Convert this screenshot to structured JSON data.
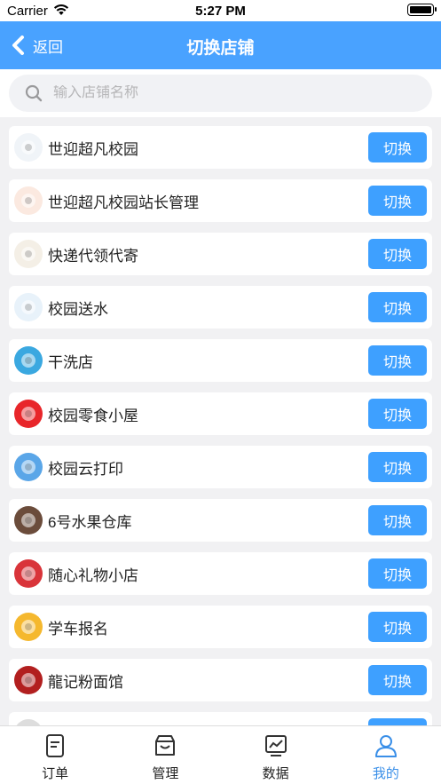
{
  "status_bar": {
    "carrier": "Carrier",
    "time": "5:27 PM"
  },
  "nav": {
    "back_label": "返回",
    "title": "切换店铺"
  },
  "search": {
    "placeholder": "输入店铺名称"
  },
  "stores": [
    {
      "name": "世迎超凡校园",
      "action": "切换",
      "icon": "mascot-logo-icon",
      "color": "#f0f4f8"
    },
    {
      "name": "世迎超凡校园站长管理",
      "action": "切换",
      "icon": "stationmaster-logo-icon",
      "color": "#fbe9e0"
    },
    {
      "name": "快递代领代寄",
      "action": "切换",
      "icon": "courier-logo-icon",
      "color": "#f4efe6"
    },
    {
      "name": "校园送水",
      "action": "切换",
      "icon": "water-delivery-logo-icon",
      "color": "#e8f2fa"
    },
    {
      "name": "干洗店",
      "action": "切换",
      "icon": "dry-cleaning-logo-icon",
      "color": "#3aa8e0"
    },
    {
      "name": "校园零食小屋",
      "action": "切换",
      "icon": "snack-house-logo-icon",
      "color": "#e8262a"
    },
    {
      "name": "校园云打印",
      "action": "切换",
      "icon": "cloud-print-logo-icon",
      "color": "#5aa6e8"
    },
    {
      "name": "6号水果仓库",
      "action": "切换",
      "icon": "fruit-warehouse-logo-icon",
      "color": "#6b4c3b"
    },
    {
      "name": "随心礼物小店",
      "action": "切换",
      "icon": "gift-shop-logo-icon",
      "color": "#d9343a"
    },
    {
      "name": "学车报名",
      "action": "切换",
      "icon": "driving-school-logo-icon",
      "color": "#f5b82e"
    },
    {
      "name": "龍记粉面馆",
      "action": "切换",
      "icon": "noodle-shop-logo-icon",
      "color": "#b21f1f"
    },
    {
      "name": "",
      "action": "切换",
      "icon": "store-logo-icon",
      "color": "#dddddd"
    }
  ],
  "tabs": [
    {
      "label": "订单",
      "icon": "order-icon",
      "active": false
    },
    {
      "label": "管理",
      "icon": "manage-icon",
      "active": false
    },
    {
      "label": "数据",
      "icon": "data-chart-icon",
      "active": false
    },
    {
      "label": "我的",
      "icon": "profile-icon",
      "active": true
    }
  ],
  "colors": {
    "primary": "#49a2ff",
    "button": "#3ea0ff",
    "active_tab": "#3a8fe8",
    "background": "#f1f1f3"
  }
}
